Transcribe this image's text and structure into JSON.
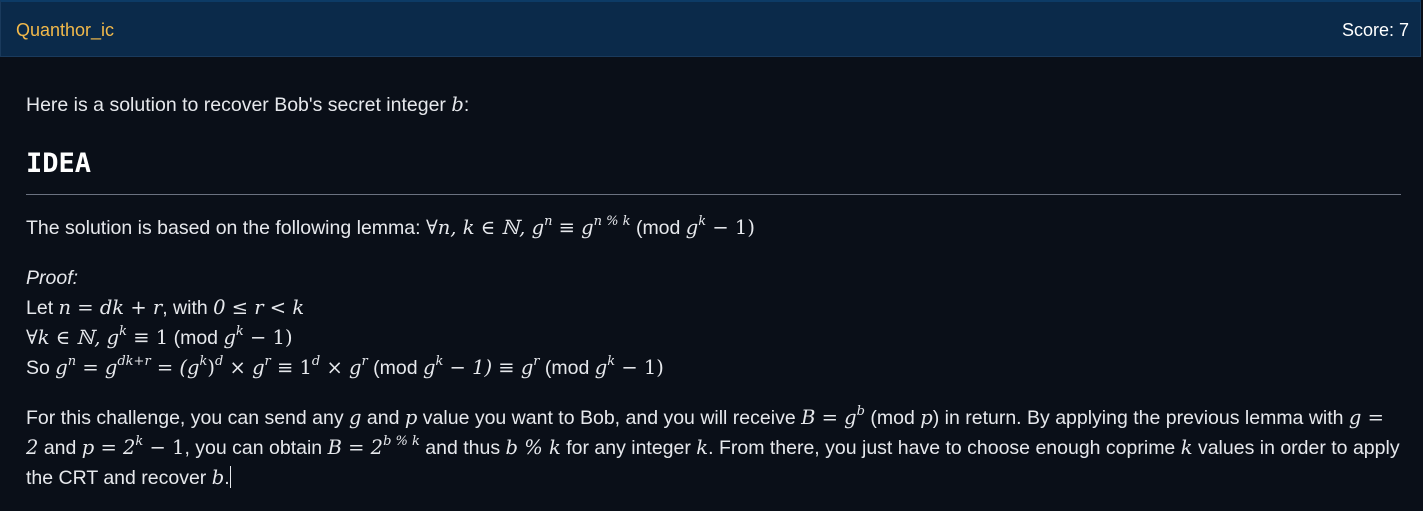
{
  "header": {
    "author": "Quanthor_ic",
    "score": "Score: 7"
  },
  "post": {
    "intro": {
      "before": "Here is a solution to recover Bob's secret integer ",
      "var_b": "b",
      "after": ":"
    },
    "heading": "IDEA",
    "lemma": {
      "prefix": "The solution is based on the following lemma: ",
      "formula": "∀n, k ∈ ℕ, g",
      "exp_n": "n",
      "equiv": " ≡ g",
      "exp_nk": "n % k",
      "mod_open": " (mod ",
      "mod_g": "g",
      "mod_k": "k",
      "mod_close": " − 1)"
    },
    "proof": {
      "title": "Proof:",
      "line1_let": "Let ",
      "line1_eq": "n = dk + r",
      "line1_with": ", with ",
      "line1_range": "0 ≤ r < k",
      "line2_pre": "∀k ∈ ℕ, g",
      "line2_k": "k",
      "line2_eq": " ≡ 1",
      "line2_mod": " (mod ",
      "line2_g": "g",
      "line2_k2": "k",
      "line2_close": " − 1)",
      "line3_so": "So ",
      "line3_g": "g",
      "line3_n": "n",
      "line3_eq": " = g",
      "line3_exp": "dk+r",
      "line3_eq2": " = (g",
      "line3_k": "k",
      "line3_paren": ")",
      "line3_d": "d",
      "line3_times": " × g",
      "line3_r": "r",
      "line3_equiv": " ≡ 1",
      "line3_d2": "d",
      "line3_times2": " × g",
      "line3_r2": "r",
      "line3_mod": " (mod ",
      "line3_modg": "g",
      "line3_modk": "k",
      "line3_modclose": " − 1) ≡ g",
      "line3_r3": "r",
      "line3_mod2": " (mod ",
      "line3_modg2": "g",
      "line3_modk2": "k",
      "line3_modclose2": " − 1)"
    },
    "challenge": {
      "t1": "For this challenge, you can send any ",
      "g": "g",
      "t2": " and ",
      "p": "p",
      "t3": " value you want to Bob, and you will receive ",
      "B_eq": "B = g",
      "b_exp": "b",
      "t4": " (mod ",
      "p2": "p",
      "t5": ") in return. By applying the previous lemma with ",
      "g_eq": "g = 2",
      "t6": " and ",
      "p_eq": "p = 2",
      "k_exp": "k",
      "p_tail": " − 1",
      "t7": ", you can obtain ",
      "B_eq2": "B = 2",
      "bk_exp": "b % k",
      "t8": " and thus ",
      "bk": "b % k",
      "t9": " for any integer ",
      "k": "k",
      "t10": ". From there, you just have to choose enough coprime ",
      "k2": "k",
      "t11": " values in order to apply the CRT and recover ",
      "b_end": "b",
      "t12": "."
    }
  }
}
